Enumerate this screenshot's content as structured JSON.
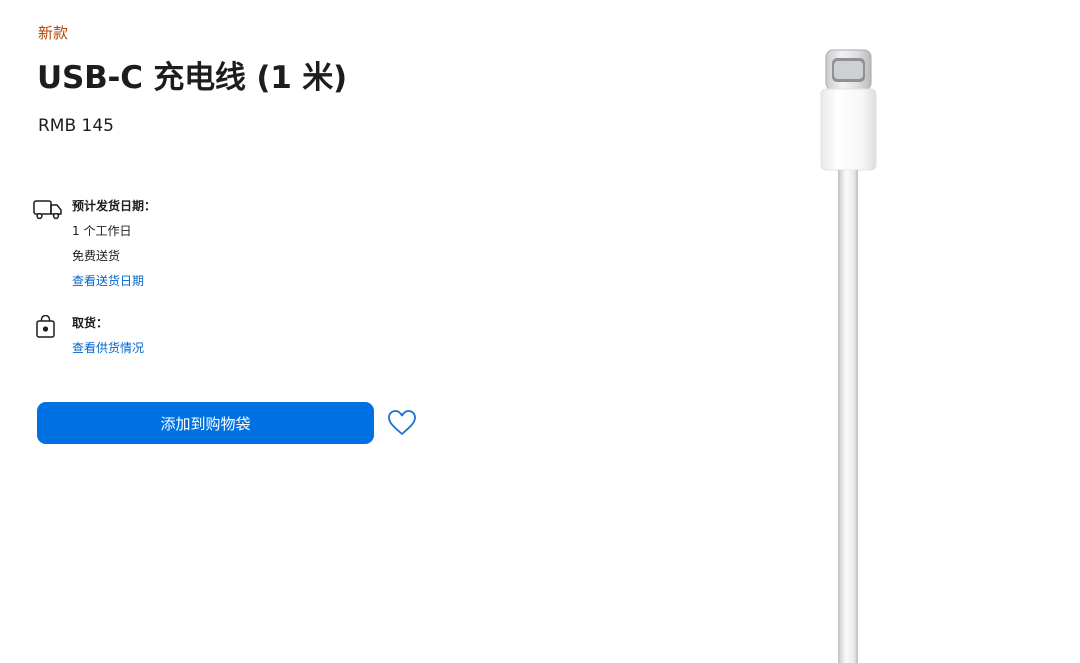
{
  "product": {
    "badge": "新款",
    "title": "USB-C 充电线 (1 米)",
    "price": "RMB 145",
    "image_alt": "USB-C 充电线"
  },
  "delivery": {
    "icon": "truck-icon",
    "heading": "预计发货日期：",
    "eta": "1 个工作日",
    "shipping": "免费送货",
    "link": "查看送货日期"
  },
  "pickup": {
    "icon": "store-bag-icon",
    "heading": "取货：",
    "link": "查看供货情况"
  },
  "actions": {
    "add_to_bag": "添加到购物袋",
    "wishlist_icon": "heart-icon"
  },
  "colors": {
    "accent": "#0071e3",
    "link": "#0066cc",
    "badge": "#b64400",
    "text": "#1d1d1f"
  }
}
